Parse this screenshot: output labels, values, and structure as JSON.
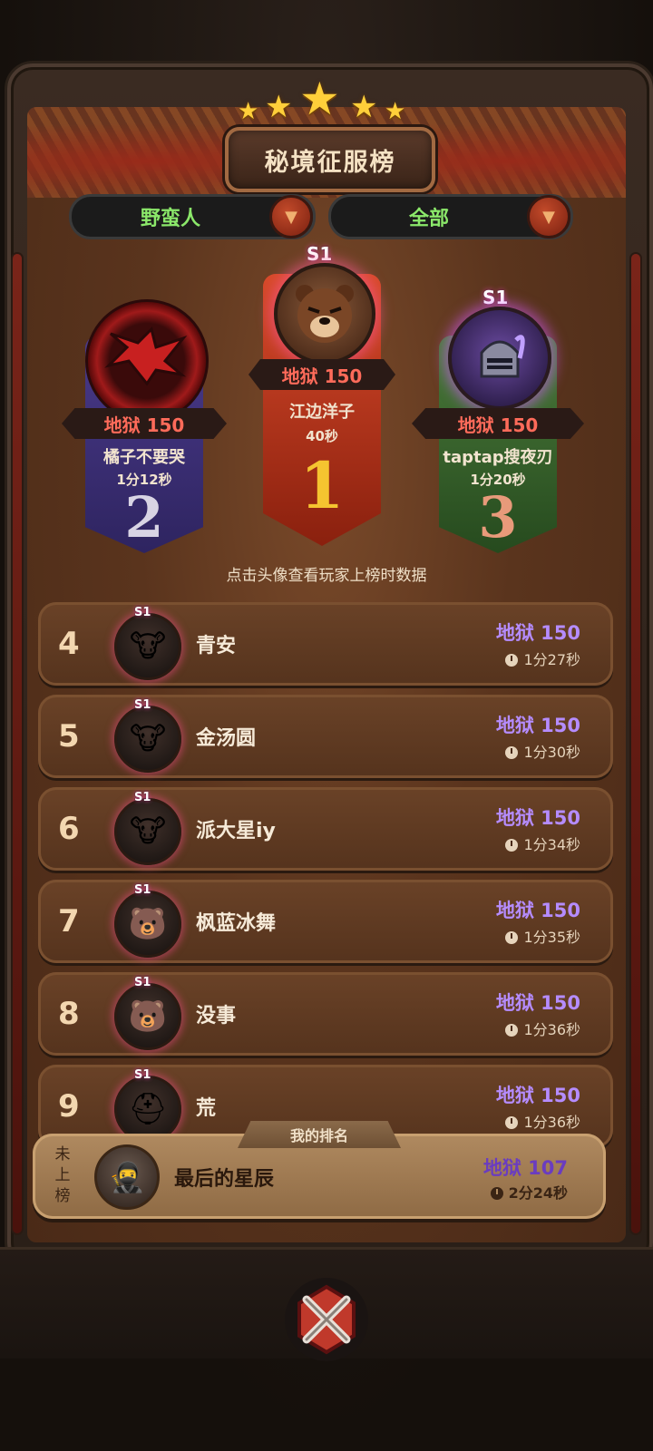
{
  "title": "秘境征服榜",
  "filters": {
    "class_label": "野蛮人",
    "scope_label": "全部",
    "arrow": "▼"
  },
  "podium": [
    {
      "place": "1",
      "season": "S1",
      "score": "地狱 150",
      "name": "江边洋子",
      "time": "40秒",
      "avatar_icon": "bear-icon"
    },
    {
      "place": "2",
      "season": "",
      "score": "地狱 150",
      "name": "橘子不要哭",
      "time": "1分12秒",
      "avatar_icon": "dragon-icon"
    },
    {
      "place": "3",
      "season": "S1",
      "score": "地狱 150",
      "name": "taptap搜夜刃",
      "time": "1分20秒",
      "avatar_icon": "knight-helmet-icon"
    }
  ],
  "hint": "点击头像查看玩家上榜时数据",
  "rows": [
    {
      "rank": "4",
      "season": "S1",
      "name": "青安",
      "score": "地狱 150",
      "time": "1分27秒",
      "avatar_icon": "cow-icon"
    },
    {
      "rank": "5",
      "season": "S1",
      "name": "金汤圆",
      "score": "地狱 150",
      "time": "1分30秒",
      "avatar_icon": "cow-icon"
    },
    {
      "rank": "6",
      "season": "S1",
      "name": "派大星iy",
      "score": "地狱 150",
      "time": "1分34秒",
      "avatar_icon": "cow-icon"
    },
    {
      "rank": "7",
      "season": "S1",
      "name": "枫蓝冰舞",
      "score": "地狱 150",
      "time": "1分35秒",
      "avatar_icon": "bear-icon"
    },
    {
      "rank": "8",
      "season": "S1",
      "name": "没事",
      "score": "地狱 150",
      "time": "1分36秒",
      "avatar_icon": "bear-icon"
    },
    {
      "rank": "9",
      "season": "S1",
      "name": "荒",
      "score": "地狱 150",
      "time": "1分36秒",
      "avatar_icon": "knight-helmet-icon"
    }
  ],
  "my_rank": {
    "tab_label": "我的排名",
    "status": "未上榜",
    "name": "最后的星辰",
    "score": "地狱 107",
    "time": "2分24秒",
    "avatar_icon": "bandit-icon"
  },
  "close_icon": "close-x-icon",
  "colors": {
    "score_red": "#ff6b5a",
    "score_purple": "#b58cff",
    "green_label": "#8be86a",
    "gold_star": "#ffcf3a"
  }
}
